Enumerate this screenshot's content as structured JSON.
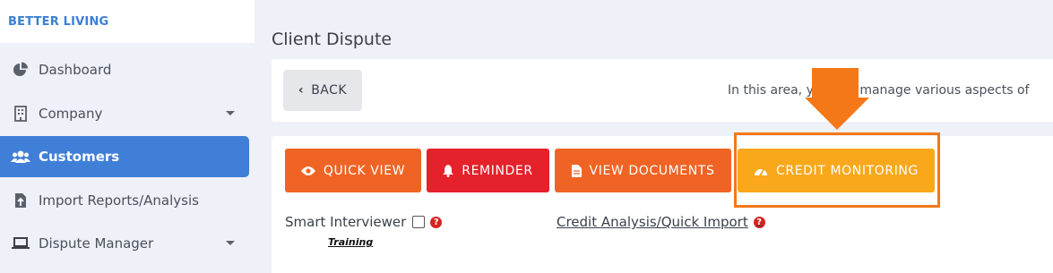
{
  "brand": {
    "name": "BETTER LIVING"
  },
  "sidebar": {
    "items": [
      {
        "label": "Dashboard",
        "icon": "pie-chart-icon"
      },
      {
        "label": "Company",
        "icon": "building-icon"
      },
      {
        "label": "Customers",
        "icon": "users-icon",
        "active": true
      },
      {
        "label": "Import Reports/Analysis",
        "icon": "file-import-icon"
      },
      {
        "label": "Dispute Manager",
        "icon": "laptop-icon"
      }
    ]
  },
  "page": {
    "title": "Client Dispute",
    "back_label": "BACK",
    "info_text": "In this area, you can manage various aspects of"
  },
  "actions": {
    "quick_view": "QUICK VIEW",
    "reminder": "REMINDER",
    "view_documents": "VIEW DOCUMENTS",
    "credit_monitoring": "CREDIT MONITORING"
  },
  "form": {
    "smart_interviewer_label": "Smart Interviewer",
    "training_link": "Training",
    "credit_analysis_link": "Credit Analysis/Quick Import"
  },
  "colors": {
    "accent_blue": "#3f7fd8",
    "orange": "#ef6424",
    "red": "#e5212b",
    "amber": "#f9a81c",
    "highlight": "#f47818"
  }
}
